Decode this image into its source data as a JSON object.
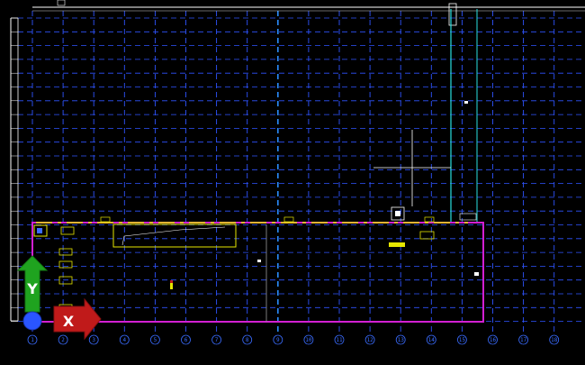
{
  "app": {
    "type": "cad-model-space-viewport",
    "background_color": "#000000"
  },
  "colors": {
    "grid_line": "#2f54ff",
    "grid_bubble": "#3a6cff",
    "major_axis": "#2a8cff",
    "building_outline": "#d21fd2",
    "wall_line": "#e6e600",
    "cyan_line": "#28e0e0",
    "crosshair": "#ffffff",
    "ucs_y": "#1fa31f",
    "ucs_x": "#c01a1a",
    "ucs_origin": "#2a55ff"
  },
  "grid": {
    "bottom_bubbles": [
      "1",
      "2",
      "3",
      "4",
      "5",
      "6",
      "7",
      "8",
      "9",
      "10",
      "11",
      "12",
      "13",
      "14",
      "15",
      "16",
      "17",
      "18"
    ],
    "left_ticks_count": 22
  },
  "ucs_icon": {
    "y_label": "Y",
    "x_label": "X"
  }
}
